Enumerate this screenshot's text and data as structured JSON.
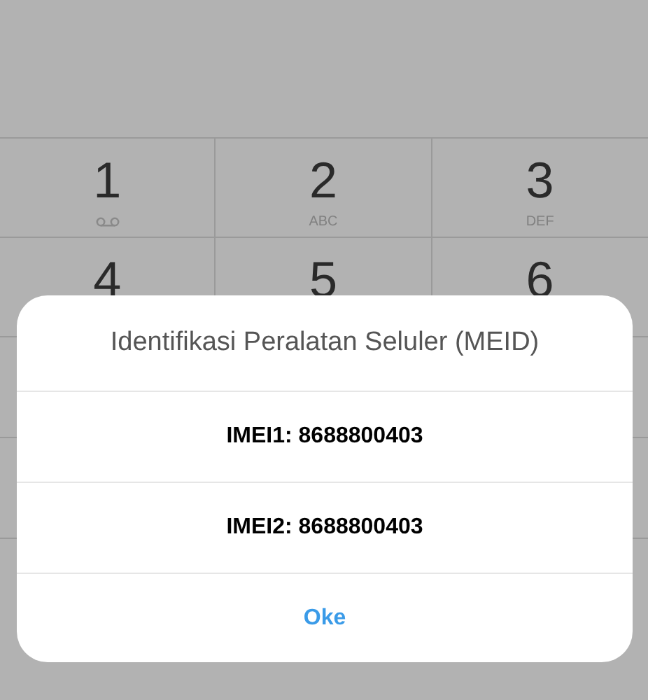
{
  "keypad": {
    "keys": [
      {
        "digit": "1",
        "kind": "voicemail"
      },
      {
        "digit": "2",
        "kind": "letters",
        "letters": "ABC"
      },
      {
        "digit": "3",
        "kind": "letters",
        "letters": "DEF"
      },
      {
        "digit": "4",
        "kind": "plain"
      },
      {
        "digit": "5",
        "kind": "plain"
      },
      {
        "digit": "6",
        "kind": "plain"
      }
    ]
  },
  "dialog": {
    "title": "Identifikasi Peralatan Seluler (MEID)",
    "items": [
      "IMEI1: 8688800403",
      "IMEI2: 8688800403"
    ],
    "button": "Oke"
  }
}
